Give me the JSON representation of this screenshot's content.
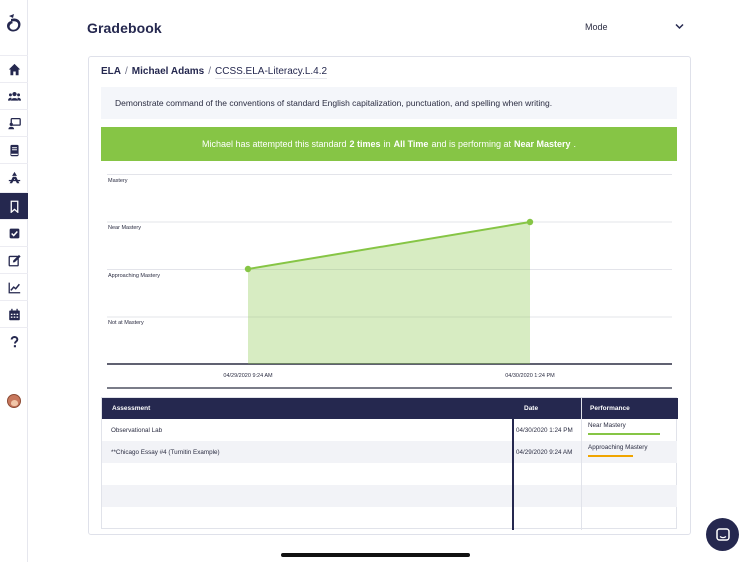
{
  "header": {
    "title": "Gradebook",
    "mode_label": "Mode"
  },
  "sidebar": {
    "items": [
      {
        "icon": "home-icon",
        "name": "home"
      },
      {
        "icon": "users-icon",
        "name": "students"
      },
      {
        "icon": "teacher-icon",
        "name": "classes"
      },
      {
        "icon": "book-icon",
        "name": "curriculum"
      },
      {
        "icon": "pen-nib-icon",
        "name": "design"
      },
      {
        "icon": "bookmark-icon",
        "name": "standards",
        "active": true
      },
      {
        "icon": "checkbox-icon",
        "name": "assignments"
      },
      {
        "icon": "edit-icon",
        "name": "edit"
      },
      {
        "icon": "chart-line-icon",
        "name": "reports"
      },
      {
        "icon": "calendar-icon",
        "name": "calendar"
      },
      {
        "icon": "question-icon",
        "name": "help"
      }
    ]
  },
  "breadcrumb": {
    "subject": "ELA",
    "student": "Michael Adams",
    "standard": "CCSS.ELA-Literacy.L.4.2",
    "separator": "/"
  },
  "standard_description": "Demonstrate command of the conventions of standard English capitalization, punctuation, and spelling when writing.",
  "banner": {
    "prefix": "Michael has attempted this standard",
    "attempts": "2 times",
    "mid": "in",
    "period": "All Time",
    "suffix_pre": "and is performing at",
    "level": "Near Mastery",
    "suffix": ".",
    "color": "#86c545"
  },
  "chart_data": {
    "type": "area",
    "y_levels": [
      "Not at Mastery",
      "Approaching Mastery",
      "Near Mastery",
      "Mastery"
    ],
    "x": [
      "04/29/2020 9:24 AM",
      "04/30/2020 1:24 PM"
    ],
    "series": [
      {
        "values": [
          "Approaching Mastery",
          "Near Mastery"
        ],
        "color": "#86c545"
      }
    ],
    "grid": true
  },
  "table": {
    "headers": {
      "assessment": "Assessment",
      "date": "Date",
      "performance": "Performance"
    },
    "rows": [
      {
        "assessment": "Observational Lab",
        "date": "04/30/2020 1:24 PM",
        "performance": "Near Mastery",
        "level": 0.8,
        "bar_color": "#86c545"
      },
      {
        "assessment": "**Chicago Essay #4 (Turnitin Example)",
        "date": "04/29/2020 9:24 AM",
        "performance": "Approaching Mastery",
        "level": 0.5,
        "bar_color": "#f0a500"
      }
    ],
    "empty_rows": 3
  },
  "colors": {
    "navy": "#25284f",
    "green": "#86c545",
    "amber": "#f0a500"
  }
}
